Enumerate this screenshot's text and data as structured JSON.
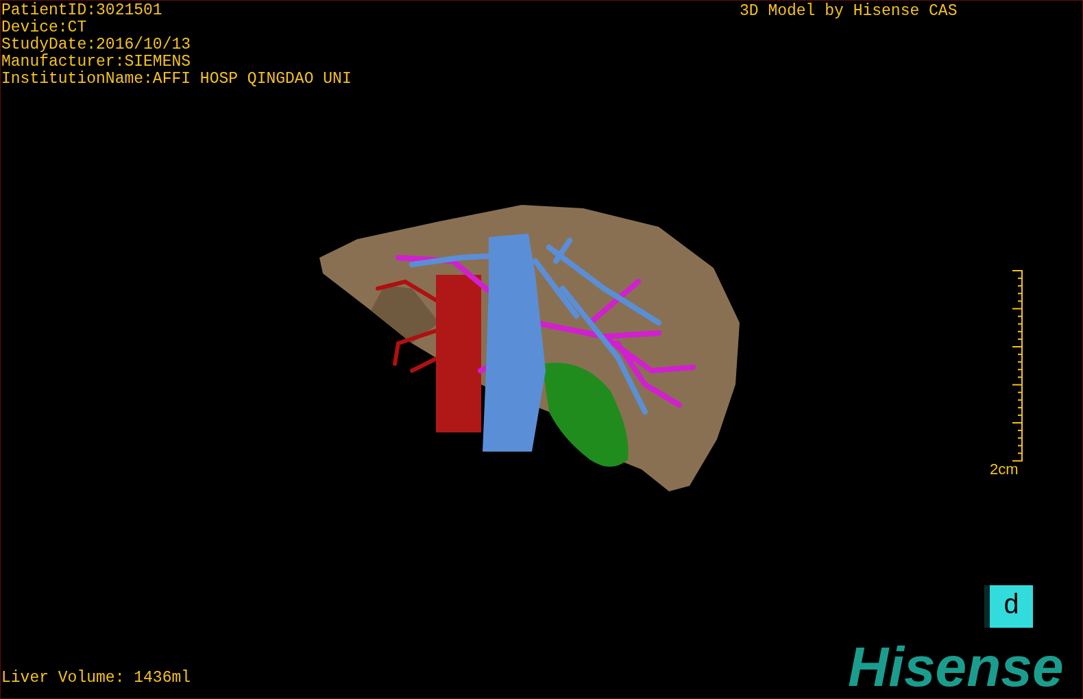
{
  "patient_info": [
    "PatientID:3021501",
    "Device:CT",
    "StudyDate:2016/10/13",
    "Manufacturer:SIEMENS",
    "InstitutionName:AFFI HOSP QINGDAO UNI"
  ],
  "title": "3D Model by Hisense CAS",
  "scale": {
    "label": "2cm"
  },
  "orientation_cube": {
    "label": "d"
  },
  "logo": "Hisense",
  "liver_volume": "Liver Volume: 1436ml"
}
